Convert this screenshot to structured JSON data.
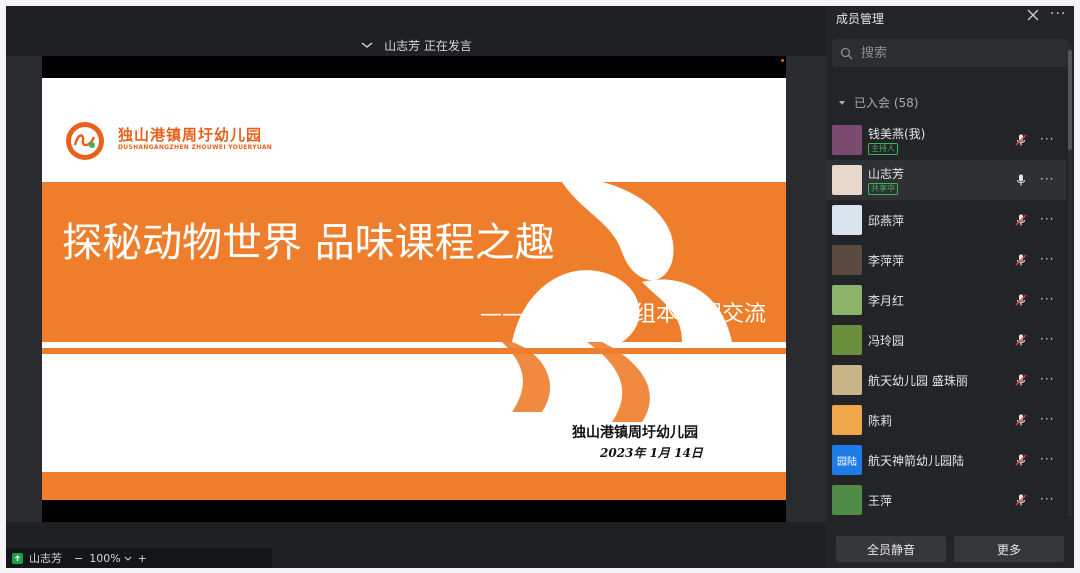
{
  "stage": {
    "speaker_text": "山志芳 正在发言",
    "slide": {
      "school_cn": "独山港镇周圩幼儿园",
      "school_en": "DUSHANGANGZHEN ZHOUWEI YOUERYUAN",
      "title": "探秘动物世界 品味课程之趣",
      "subtitle": "——周圩教研组组本课程交流",
      "sign_name": "独山港镇周圩幼儿园",
      "sign_date": "2023年 1月 14日"
    },
    "bottom_bar": {
      "sharer": "山志芳",
      "zoom_minus": "−",
      "zoom_value": "100%",
      "zoom_plus": "+"
    }
  },
  "panel": {
    "title": "成员管理",
    "more": "···",
    "search_placeholder": "搜索",
    "group_label": "已入会 (58)",
    "members": [
      {
        "name": "钱美燕(我)",
        "tag": "主持人",
        "mic": "muted",
        "avatar_color": "#7a4b6e"
      },
      {
        "name": "山志芳",
        "tag": "共享中",
        "mic": "on",
        "avatar_color": "#e8d8cc"
      },
      {
        "name": "邱燕萍",
        "tag": "",
        "mic": "muted",
        "avatar_color": "#d9e4ef"
      },
      {
        "name": "李萍萍",
        "tag": "",
        "mic": "muted",
        "avatar_color": "#5a4a40"
      },
      {
        "name": "李月红",
        "tag": "",
        "mic": "muted",
        "avatar_color": "#8bb36a"
      },
      {
        "name": "冯玲园",
        "tag": "",
        "mic": "muted",
        "avatar_color": "#6c8f3d"
      },
      {
        "name": "航天幼儿园 盛珠丽",
        "tag": "",
        "mic": "muted",
        "avatar_color": "#c9b48a"
      },
      {
        "name": "陈莉",
        "tag": "",
        "mic": "muted",
        "avatar_color": "#f0a64a"
      },
      {
        "name": "航天神箭幼儿园陆",
        "tag": "",
        "mic": "muted",
        "avatar_color": "#1e7ce8",
        "avatar_text": "园陆"
      },
      {
        "name": "王萍",
        "tag": "",
        "mic": "muted",
        "avatar_color": "#4f8b46"
      }
    ],
    "mute_all": "全员静音",
    "more_button": "更多"
  },
  "colors": {
    "brand_orange": "#ee7d2c",
    "panel_bg": "#232428",
    "host_tag": "#3bb35a"
  }
}
